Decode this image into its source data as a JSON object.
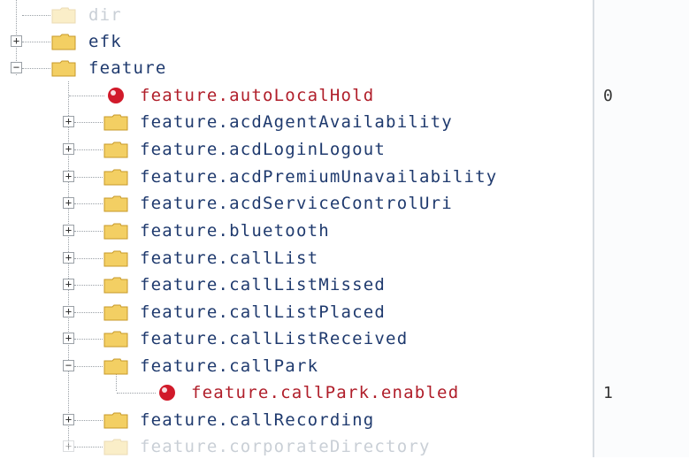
{
  "tree": {
    "top_items": [
      {
        "label": "dir",
        "state": "partial"
      },
      {
        "label": "efk",
        "state": "collapsed"
      },
      {
        "label": "feature",
        "state": "expanded"
      }
    ],
    "feature_children": [
      {
        "label": "feature.autoLocalHold",
        "type": "leaf",
        "value": "0"
      },
      {
        "label": "feature.acdAgentAvailability",
        "type": "folder",
        "state": "collapsed"
      },
      {
        "label": "feature.acdLoginLogout",
        "type": "folder",
        "state": "collapsed"
      },
      {
        "label": "feature.acdPremiumUnavailability",
        "type": "folder",
        "state": "collapsed"
      },
      {
        "label": "feature.acdServiceControlUri",
        "type": "folder",
        "state": "collapsed"
      },
      {
        "label": "feature.bluetooth",
        "type": "folder",
        "state": "collapsed"
      },
      {
        "label": "feature.callList",
        "type": "folder",
        "state": "collapsed"
      },
      {
        "label": "feature.callListMissed",
        "type": "folder",
        "state": "collapsed"
      },
      {
        "label": "feature.callListPlaced",
        "type": "folder",
        "state": "collapsed"
      },
      {
        "label": "feature.callListReceived",
        "type": "folder",
        "state": "collapsed"
      },
      {
        "label": "feature.callPark",
        "type": "folder",
        "state": "expanded"
      },
      {
        "label": "feature.callPark.enabled",
        "type": "leaf",
        "value": "1"
      },
      {
        "label": "feature.callRecording",
        "type": "folder",
        "state": "collapsed"
      },
      {
        "label": "feature.corporateDirectory",
        "type": "folder",
        "state": "collapsed"
      }
    ]
  },
  "values": {
    "autoLocalHold": "0",
    "callParkEnabled": "1"
  },
  "colors": {
    "folder_label": "#1f3a6e",
    "leaf_label": "#b01e2a",
    "folder_fill": "#f3cf63",
    "leaf_icon": "#d11a2a"
  },
  "icons": {
    "folder": "folder-icon",
    "leaf": "setting-leaf-icon",
    "expand": "plus-box-icon",
    "collapse": "minus-box-icon"
  }
}
